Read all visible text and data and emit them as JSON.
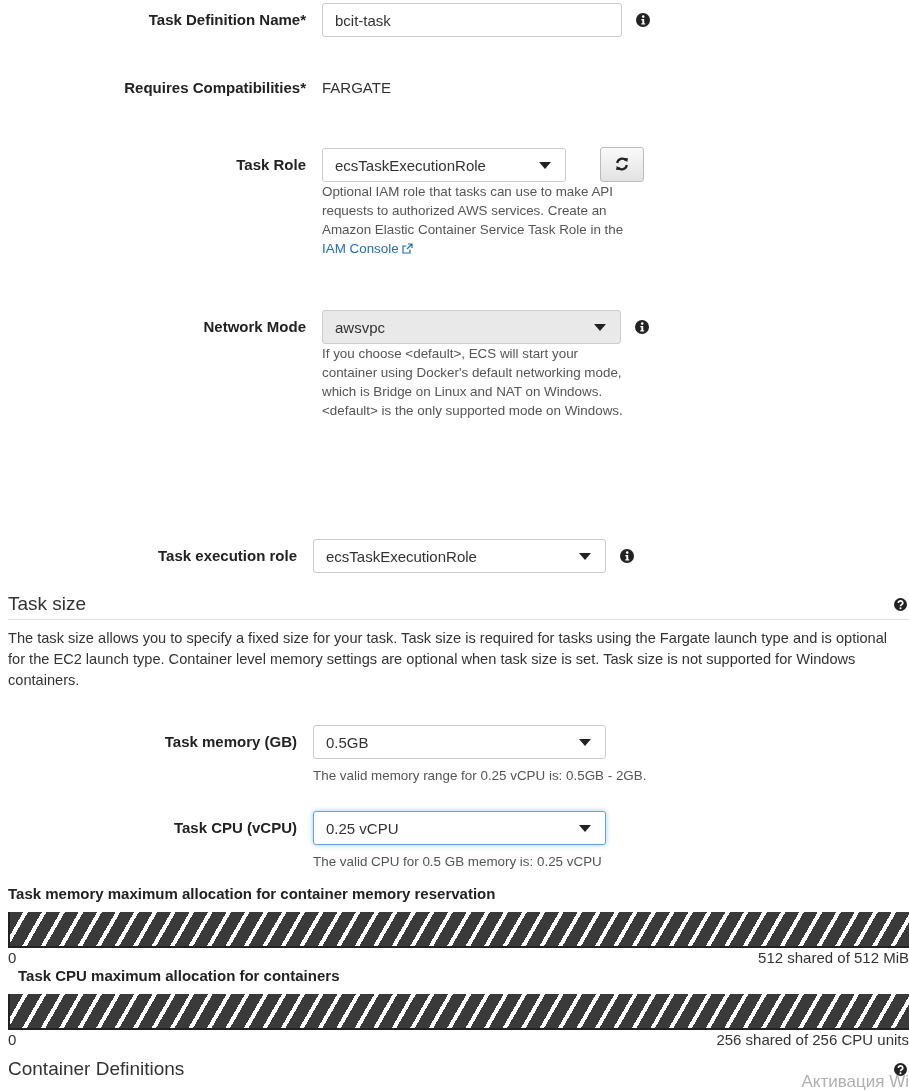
{
  "task_definition": [
    {
      "kind": "text",
      "label": "Task Definition Name*",
      "value": "bcit-task",
      "info": true
    },
    {
      "kind": "static",
      "label": "Requires Compatibilities*",
      "value": "FARGATE"
    },
    {
      "kind": "select",
      "label": "Task Role",
      "value": "ecsTaskExecutionRole",
      "disabled": false,
      "focused": false,
      "refresh": true,
      "help": "Optional IAM role that tasks can use to make API requests to authorized AWS services. Create an Amazon Elastic Container Service Task Role in the",
      "link": "IAM Console"
    },
    {
      "kind": "select",
      "label": "Network Mode",
      "value": "awsvpc",
      "disabled": true,
      "focused": false,
      "info": true,
      "help": "If you choose <default>, ECS will start your container using Docker's default networking mode, which is Bridge on Linux and NAT on Windows. <default> is the only supported mode on Windows."
    },
    {
      "kind": "select",
      "label": "Task execution role",
      "value": "ecsTaskExecutionRole",
      "disabled": false,
      "focused": false,
      "info": true
    }
  ],
  "task_size": {
    "title": "Task size",
    "description": "The task size allows you to specify a fixed size for your task. Task size is required for tasks using the Fargate launch type and is optional for the EC2 launch type. Container level memory settings are optional when task size is set. Task size is not supported for Windows containers.",
    "fields": [
      {
        "kind": "select",
        "label": "Task memory (GB)",
        "value": "0.5GB",
        "disabled": false,
        "focused": false,
        "help": "The valid memory range for 0.25 vCPU is: 0.5GB - 2GB."
      },
      {
        "kind": "select",
        "label": "Task CPU (vCPU)",
        "value": "0.25 vCPU",
        "disabled": false,
        "focused": true,
        "help": "The valid CPU for 0.5 GB memory is: 0.25 vCPU"
      }
    ],
    "allocations": [
      {
        "title": "Task memory maximum allocation for container memory reservation",
        "level": 1,
        "min": "0",
        "reading": "512 shared of 512 MiB"
      },
      {
        "title": "Task CPU maximum allocation for containers",
        "level": 1,
        "min": "0",
        "reading": "256 shared of 256 CPU units"
      }
    ]
  },
  "container_definitions": {
    "title": "Container Definitions"
  },
  "os_overlay": {
    "text": "Активация Wi"
  }
}
